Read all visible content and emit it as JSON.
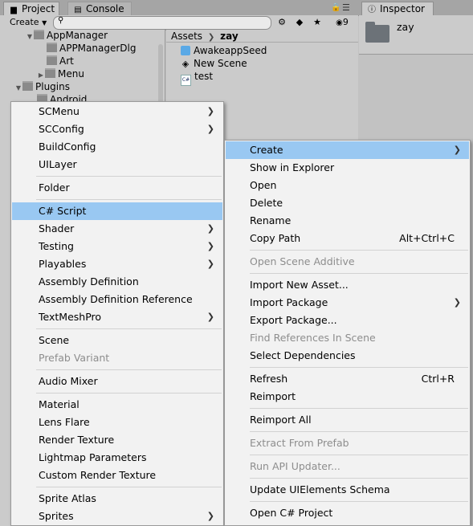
{
  "tabs": {
    "project": "Project",
    "console": "Console",
    "inspector": "Inspector"
  },
  "toolbar": {
    "create_label": "Create",
    "hidden_count": "9"
  },
  "tree": {
    "items": [
      {
        "label": "AppManager"
      },
      {
        "label": "APPManagerDlg"
      },
      {
        "label": "Art"
      },
      {
        "label": "Menu"
      },
      {
        "label": "Plugins"
      },
      {
        "label": "Android"
      }
    ]
  },
  "assets": {
    "breadcrumb_root": "Assets",
    "breadcrumb_current": "zay",
    "files": [
      {
        "label": "AwakeappSeed",
        "icon": "unity-package-icon"
      },
      {
        "label": "New Scene",
        "icon": "unity-scene-icon"
      },
      {
        "label": "test",
        "icon": "csharp-script-icon",
        "badge": "C#"
      }
    ]
  },
  "inspector": {
    "folder_name": "zay"
  },
  "menu_left": {
    "items": [
      {
        "label": "SCMenu",
        "submenu": true
      },
      {
        "label": "SCConfig",
        "submenu": true
      },
      {
        "label": "BuildConfig"
      },
      {
        "label": "UILayer"
      },
      {
        "label": "Folder"
      },
      {
        "label": "C# Script",
        "selected": true
      },
      {
        "label": "Shader",
        "submenu": true
      },
      {
        "label": "Testing",
        "submenu": true
      },
      {
        "label": "Playables",
        "submenu": true
      },
      {
        "label": "Assembly Definition"
      },
      {
        "label": "Assembly Definition Reference"
      },
      {
        "label": "TextMeshPro",
        "submenu": true
      },
      {
        "label": "Scene"
      },
      {
        "label": "Prefab Variant",
        "disabled": true
      },
      {
        "label": "Audio Mixer"
      },
      {
        "label": "Material"
      },
      {
        "label": "Lens Flare"
      },
      {
        "label": "Render Texture"
      },
      {
        "label": "Lightmap Parameters"
      },
      {
        "label": "Custom Render Texture"
      },
      {
        "label": "Sprite Atlas"
      },
      {
        "label": "Sprites",
        "submenu": true
      }
    ]
  },
  "menu_right": {
    "items": [
      {
        "label": "Create",
        "submenu": true,
        "selected": true
      },
      {
        "label": "Show in Explorer"
      },
      {
        "label": "Open"
      },
      {
        "label": "Delete"
      },
      {
        "label": "Rename"
      },
      {
        "label": "Copy Path",
        "shortcut": "Alt+Ctrl+C"
      },
      {
        "label": "Open Scene Additive",
        "disabled": true
      },
      {
        "label": "Import New Asset..."
      },
      {
        "label": "Import Package",
        "submenu": true
      },
      {
        "label": "Export Package..."
      },
      {
        "label": "Find References In Scene",
        "disabled": true
      },
      {
        "label": "Select Dependencies"
      },
      {
        "label": "Refresh",
        "shortcut": "Ctrl+R"
      },
      {
        "label": "Reimport"
      },
      {
        "label": "Reimport All"
      },
      {
        "label": "Extract From Prefab",
        "disabled": true
      },
      {
        "label": "Run API Updater...",
        "disabled": true
      },
      {
        "label": "Update UIElements Schema"
      },
      {
        "label": "Open C# Project"
      }
    ]
  },
  "colors": {
    "selection": "#99c8f2",
    "menu_bg": "#f2f2f2",
    "disabled_text": "#8d8d8d"
  }
}
